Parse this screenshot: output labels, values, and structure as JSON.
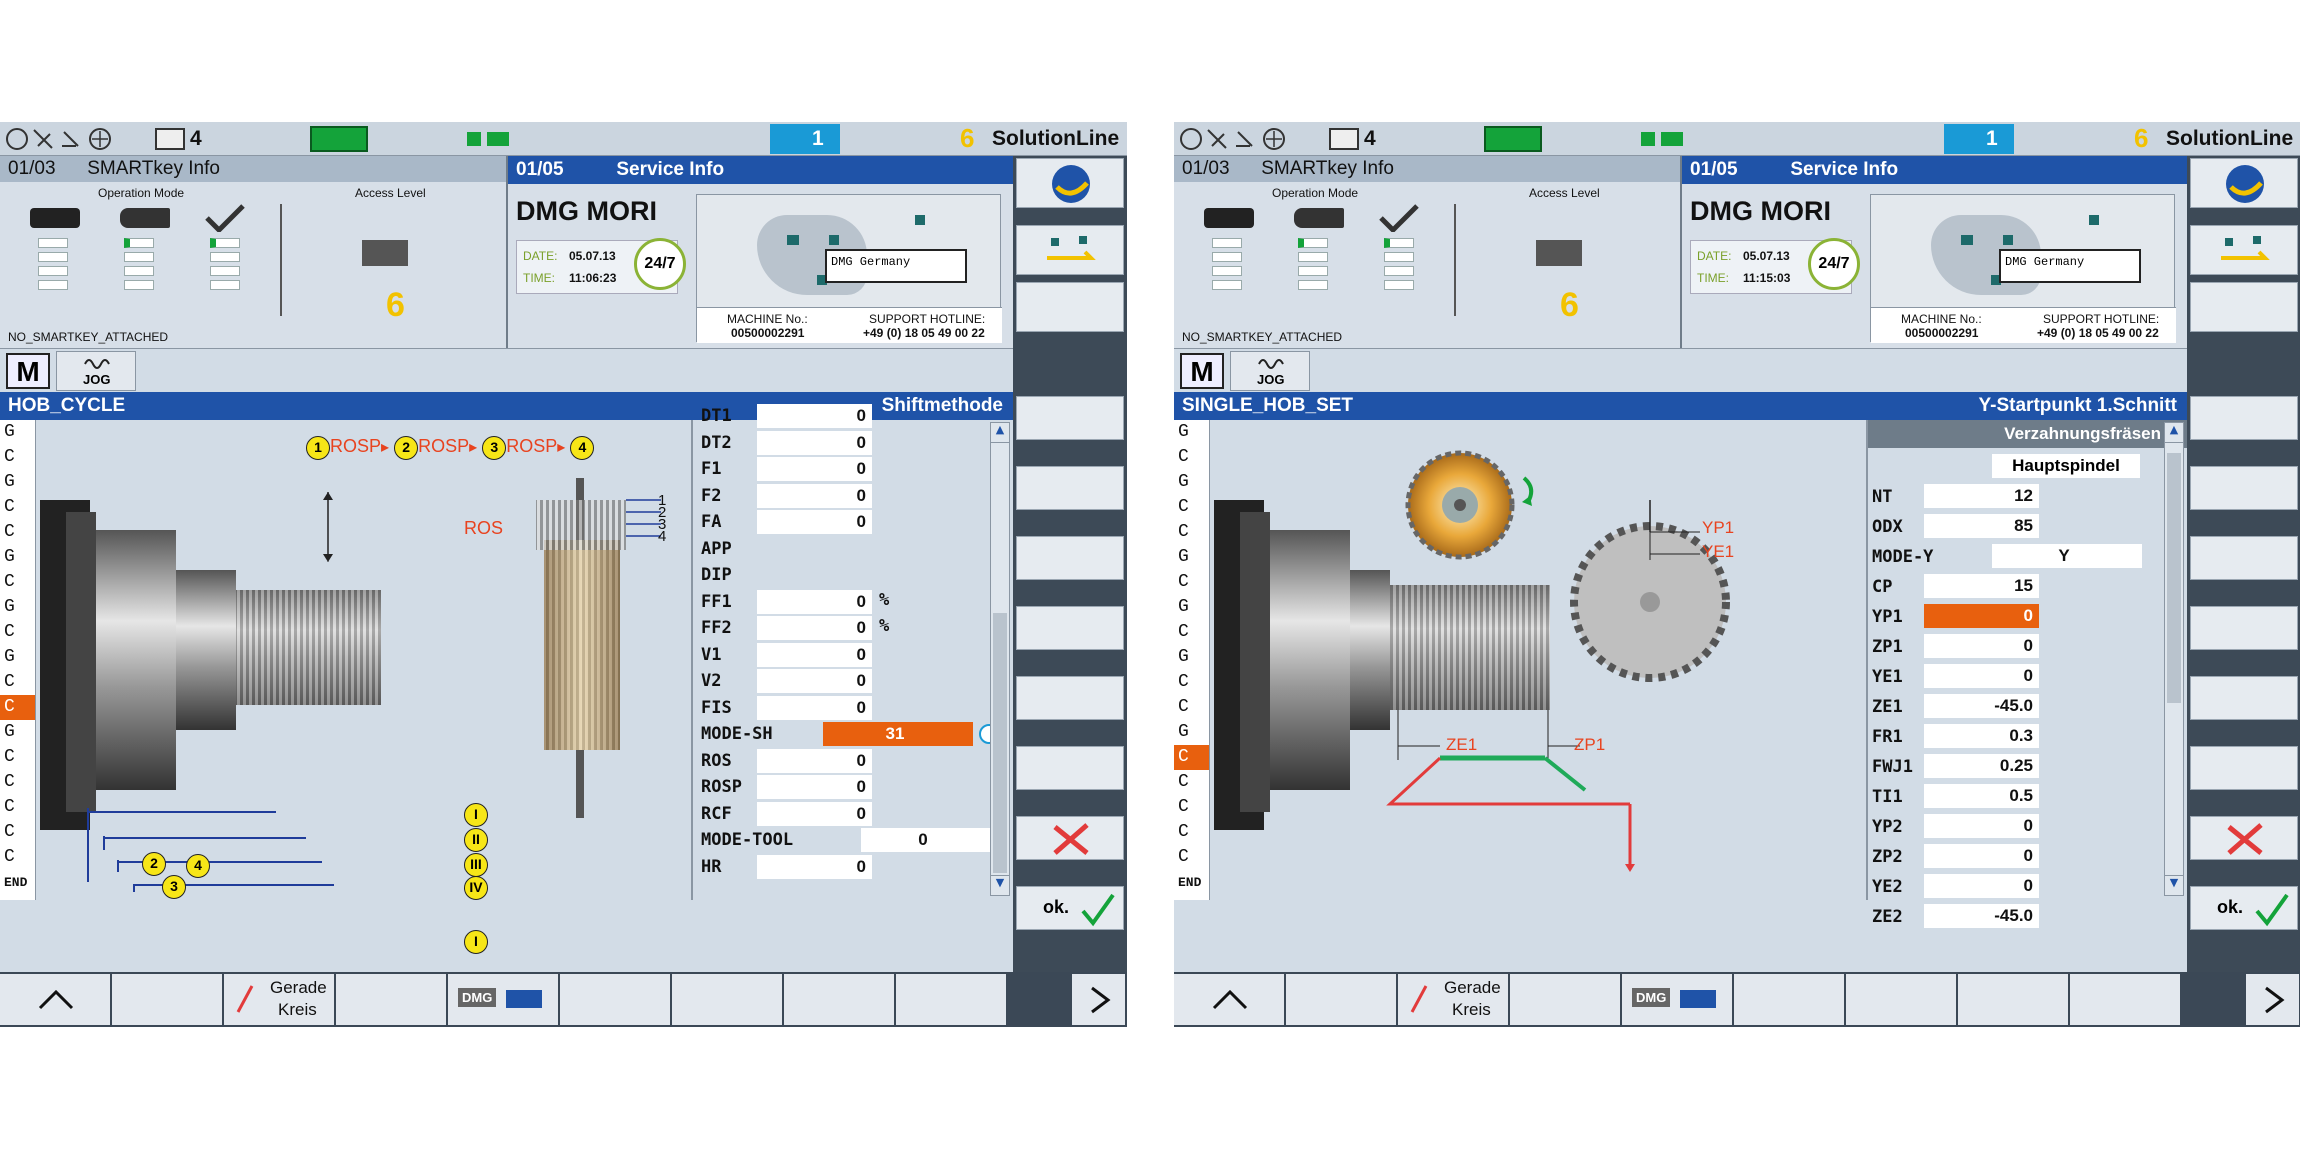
{
  "screens": [
    {
      "id": "left",
      "topbar": {
        "count_a": "4",
        "count_b": "1",
        "count_c": "6",
        "brand": "SolutionLine"
      },
      "smartkey": {
        "page": "01/03",
        "title": "SMARTkey Info",
        "operation_mode_label": "Operation Mode",
        "access_level_label": "Access Level",
        "access_value": "6",
        "status": "NO_SMARTKEY_ATTACHED"
      },
      "service": {
        "page": "01/05",
        "title": "Service Info",
        "logo": "DMG MORI",
        "date_label": "DATE:",
        "date": "05.07.13",
        "time_label": "TIME:",
        "time": "11:06:23",
        "badge": "24/7",
        "map_label": "DMG Germany",
        "machine_label": "MACHINE No.:",
        "machine_no": "00500002291",
        "hotline_label": "SUPPORT HOTLINE:",
        "hotline": "+49 (0) 18 05 49 00 22"
      },
      "mode": {
        "m": "M",
        "jog": "JOG"
      },
      "cycle": {
        "name": "HOB_CYCLE",
        "right_title": "Shiftmethode"
      },
      "gcodes": [
        "G",
        "C",
        "G",
        "C",
        "C",
        "G",
        "C",
        "G",
        "C",
        "G",
        "C",
        "C",
        "G",
        "C",
        "C",
        "C",
        "C",
        "C",
        "END"
      ],
      "selected_g": 11,
      "params": [
        {
          "label": "DT1",
          "value": "0"
        },
        {
          "label": "DT2",
          "value": "0"
        },
        {
          "label": "F1",
          "value": "0"
        },
        {
          "label": "F2",
          "value": "0"
        },
        {
          "label": "FA",
          "value": "0"
        },
        {
          "label": "APP",
          "value": ""
        },
        {
          "label": "DIP",
          "value": ""
        },
        {
          "label": "FF1",
          "value": "0",
          "unit": "%"
        },
        {
          "label": "FF2",
          "value": "0",
          "unit": "%"
        },
        {
          "label": "V1",
          "value": "0"
        },
        {
          "label": "V2",
          "value": "0"
        },
        {
          "label": "FIS",
          "value": "0"
        },
        {
          "label": "MODE-SH",
          "value": "31"
        },
        {
          "label": "ROS",
          "value": "0"
        },
        {
          "label": "ROSP",
          "value": "0"
        },
        {
          "label": "RCF",
          "value": "0"
        },
        {
          "label": "MODE-TOOL",
          "value": "0"
        },
        {
          "label": "HR",
          "value": "0"
        }
      ],
      "diagram": {
        "seq": [
          "1",
          "ROSP",
          "2",
          "ROSP",
          "3",
          "ROSP",
          "4"
        ],
        "ros": "ROS",
        "marks": [
          "1",
          "2",
          "3",
          "4"
        ],
        "roman": [
          "I",
          "II",
          "III",
          "IV"
        ],
        "nums": [
          "1",
          "2",
          "3",
          "4"
        ]
      },
      "softkeys": {
        "ok": "ok."
      },
      "bottom": {
        "up": "^",
        "gerade": "Gerade",
        "kreis": "Kreis",
        "dmg": "DMG",
        "next": ">"
      }
    },
    {
      "id": "right",
      "topbar": {
        "count_a": "4",
        "count_b": "1",
        "count_c": "6",
        "brand": "SolutionLine"
      },
      "smartkey": {
        "page": "01/03",
        "title": "SMARTkey Info",
        "operation_mode_label": "Operation Mode",
        "access_level_label": "Access Level",
        "access_value": "6",
        "status": "NO_SMARTKEY_ATTACHED"
      },
      "service": {
        "page": "01/05",
        "title": "Service Info",
        "logo": "DMG MORI",
        "date_label": "DATE:",
        "date": "05.07.13",
        "time_label": "TIME:",
        "time": "11:15:03",
        "badge": "24/7",
        "map_label": "DMG Germany",
        "machine_label": "MACHINE No.:",
        "machine_no": "00500002291",
        "hotline_label": "SUPPORT HOTLINE:",
        "hotline": "+49 (0) 18 05 49 00 22"
      },
      "mode": {
        "m": "M",
        "jog": "JOG"
      },
      "cycle": {
        "name": "SINGLE_HOB_SET",
        "right_title": "Y-Startpunkt 1.Schnitt",
        "section": "Verzahnungsfräsen",
        "spindle": "Hauptspindel"
      },
      "gcodes": [
        "G",
        "C",
        "G",
        "C",
        "C",
        "G",
        "C",
        "G",
        "C",
        "G",
        "C",
        "C",
        "G",
        "C",
        "C",
        "C",
        "C",
        "C",
        "END"
      ],
      "selected_g": 13,
      "params": [
        {
          "label": "NT",
          "value": "12"
        },
        {
          "label": "ODX",
          "value": "85"
        },
        {
          "label": "MODE-Y",
          "value": "Y"
        },
        {
          "label": "CP",
          "value": "15"
        },
        {
          "label": "YP1",
          "value": "0"
        },
        {
          "label": "ZP1",
          "value": "0"
        },
        {
          "label": "YE1",
          "value": "0"
        },
        {
          "label": "ZE1",
          "value": "-45.0"
        },
        {
          "label": "FR1",
          "value": "0.3"
        },
        {
          "label": "FWJ1",
          "value": "0.25"
        },
        {
          "label": "TI1",
          "value": "0.5"
        },
        {
          "label": "YP2",
          "value": "0"
        },
        {
          "label": "ZP2",
          "value": "0"
        },
        {
          "label": "YE2",
          "value": "0"
        },
        {
          "label": "ZE2",
          "value": "-45.0"
        }
      ],
      "diagram": {
        "yp1": "YP1",
        "ye1": "YE1",
        "ze1": "ZE1",
        "zp1": "ZP1"
      },
      "softkeys": {
        "ok": "ok."
      },
      "bottom": {
        "up": "^",
        "gerade": "Gerade",
        "kreis": "Kreis",
        "dmg": "DMG",
        "next": ">"
      }
    }
  ],
  "colors": {
    "accent_blue": "#1f53a8",
    "highlight_orange": "#e8600e",
    "gear_yellow": "#f7e617"
  }
}
